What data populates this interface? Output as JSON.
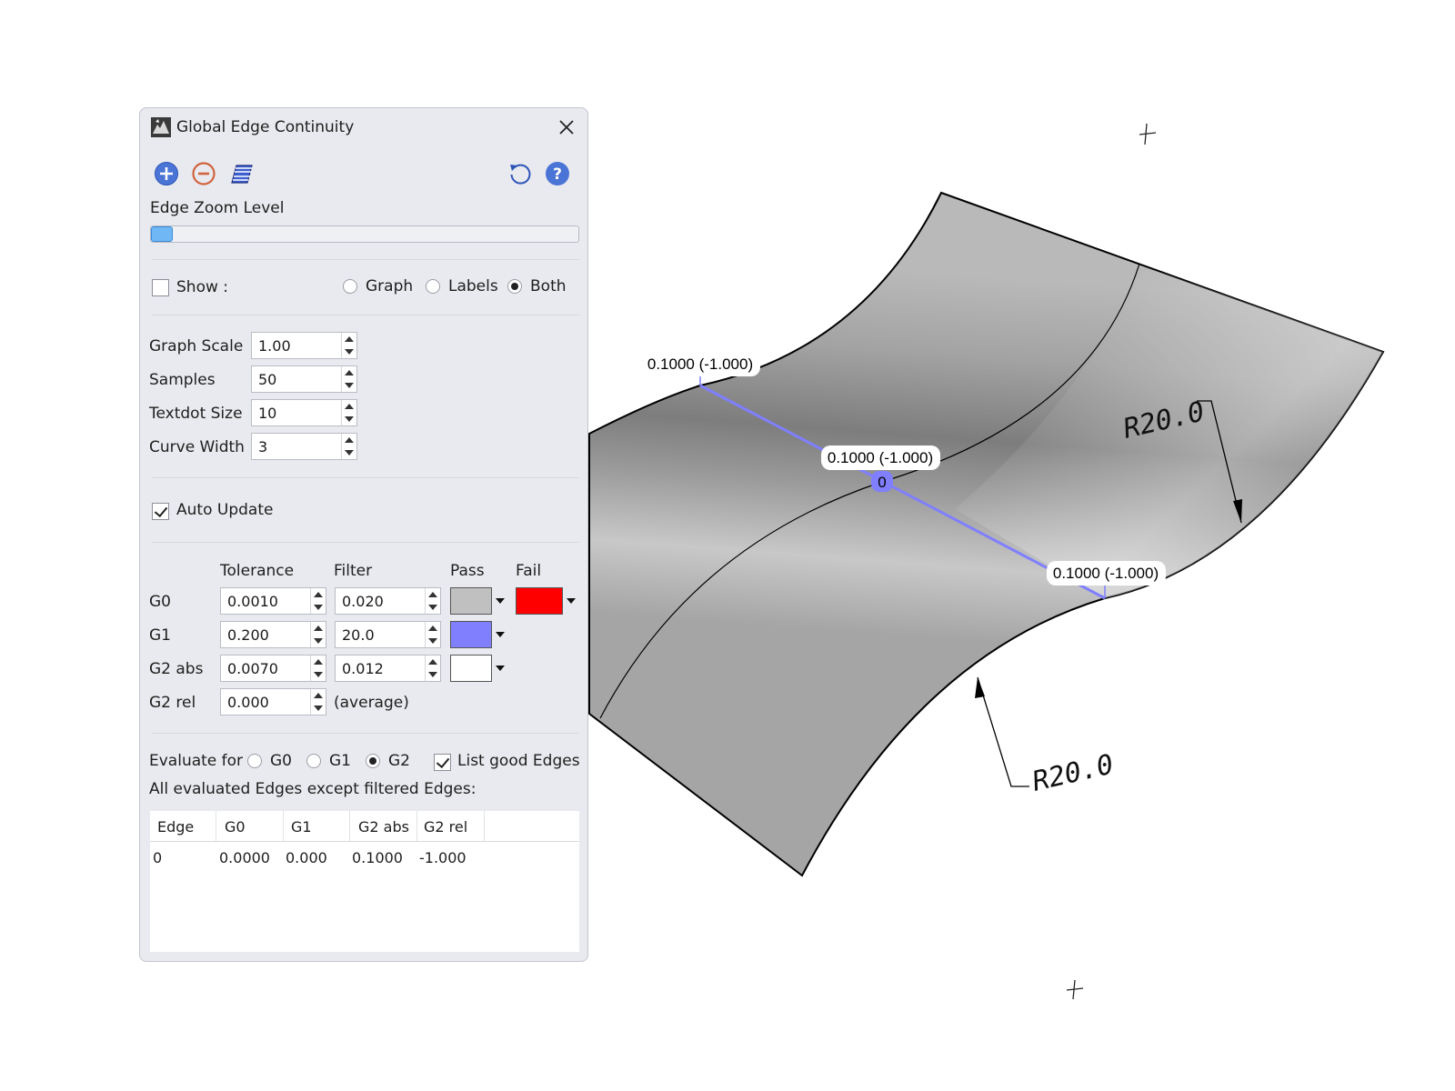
{
  "panel": {
    "title": "Global Edge Continuity",
    "toolbar_icons": [
      "add-icon",
      "remove-icon",
      "surface-icon",
      "reset-icon",
      "help-icon"
    ],
    "zoom_label": "Edge Zoom Level",
    "zoom_value": 0.02,
    "show": {
      "label": "Show :",
      "checked": false,
      "options": [
        "Graph",
        "Labels",
        "Both"
      ],
      "selected": "Both"
    },
    "fields": [
      {
        "label": "Graph Scale",
        "value": "1.00"
      },
      {
        "label": "Samples",
        "value": "50"
      },
      {
        "label": "Textdot Size",
        "value": "10"
      },
      {
        "label": "Curve Width",
        "value": "3"
      }
    ],
    "auto_update": {
      "label": "Auto Update",
      "checked": true
    },
    "grid": {
      "headers": {
        "tolerance": "Tolerance",
        "filter": "Filter",
        "pass": "Pass",
        "fail": "Fail"
      },
      "rows": [
        {
          "label": "G0",
          "tolerance": "0.0010",
          "filter": "0.020",
          "pass": "#c0c0c0",
          "fail": "#ff0000"
        },
        {
          "label": "G1",
          "tolerance": "0.200",
          "filter": "20.0",
          "pass": "#8080ff"
        },
        {
          "label": "G2 abs",
          "tolerance": "0.0070",
          "filter": "0.012",
          "pass": "#ffffff"
        },
        {
          "label": "G2 rel",
          "tolerance": "0.000",
          "note": "(average)"
        }
      ]
    },
    "evaluate": {
      "label": "Evaluate for",
      "options": [
        "G0",
        "G1",
        "G2"
      ],
      "selected": "G2",
      "list_good_label": "List good Edges",
      "list_good_checked": true
    },
    "list_caption": "All evaluated Edges except filtered Edges:",
    "table": {
      "columns": [
        "Edge",
        "G0",
        "G1",
        "G2 abs",
        "G2 rel"
      ],
      "rows": [
        [
          "0",
          "0.0000",
          "0.000",
          "0.1000",
          "-1.000"
        ]
      ]
    }
  },
  "viewport": {
    "edge_labels": [
      "0.1000 (-1.000)",
      "0.1000 (-1.000)",
      "0.1000 (-1.000)"
    ],
    "edge_index": "0",
    "dimensions": [
      "R20.0",
      "R20.0"
    ],
    "colors": {
      "surface": "#a6a6a6",
      "edge_curve": "#7f7fff"
    }
  }
}
